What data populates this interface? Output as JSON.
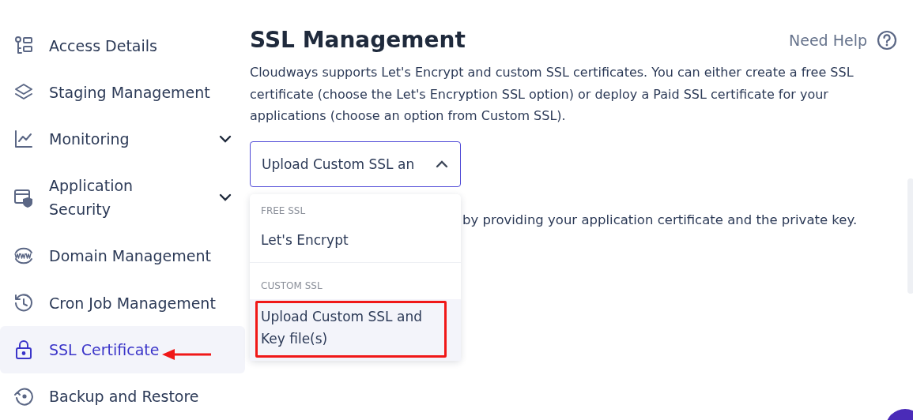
{
  "sidebar": {
    "items": [
      {
        "label": "Access Details",
        "expandable": false,
        "selected": false
      },
      {
        "label": "Staging Management",
        "expandable": false,
        "selected": false
      },
      {
        "label": "Monitoring",
        "expandable": true,
        "selected": false
      },
      {
        "label": "Application Security",
        "expandable": true,
        "selected": false
      },
      {
        "label": "Domain Management",
        "expandable": false,
        "selected": false
      },
      {
        "label": "Cron Job Management",
        "expandable": false,
        "selected": false
      },
      {
        "label": "SSL Certificate",
        "expandable": false,
        "selected": true
      },
      {
        "label": "Backup and Restore",
        "expandable": false,
        "selected": false
      }
    ]
  },
  "main": {
    "title": "SSL Management",
    "help": "Need Help",
    "description": "Cloudways supports Let's Encrypt and custom SSL certificates. You can either create a free SSL certificate (choose the Let's Encryption SSL option) or deploy a Paid SSL certificate for your applications (choose an option from Custom SSL).",
    "select": {
      "value": "Upload Custom SSL an",
      "expanded": true
    },
    "menu": [
      {
        "heading": "FREE SSL",
        "options": [
          {
            "label": "Let's Encrypt",
            "selected": false
          }
        ]
      },
      {
        "heading": "CUSTOM SSL",
        "options": [
          {
            "label": "Upload Custom SSL and Key file(s)",
            "selected": true
          }
        ]
      }
    ],
    "note": "by providing your application certificate and the private key."
  }
}
